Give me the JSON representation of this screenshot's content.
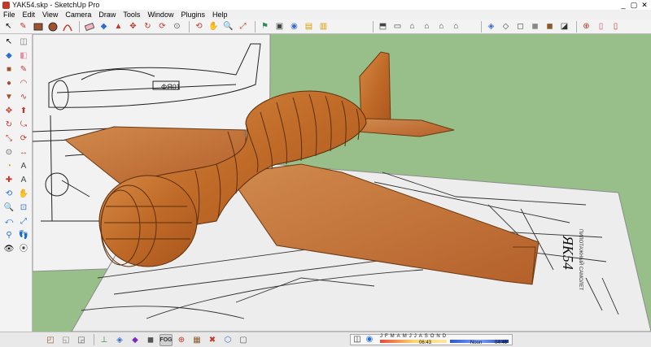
{
  "window": {
    "title": "YAK54.skp - SketchUp Pro",
    "controls": [
      "_",
      "▢",
      "✕"
    ]
  },
  "menu": [
    "File",
    "Edit",
    "View",
    "Camera",
    "Draw",
    "Tools",
    "Window",
    "Plugins",
    "Help"
  ],
  "toolbar_top": {
    "left_icons": [
      "select-arrow-icon",
      "pencil-line-icon",
      "rectangle-icon",
      "circle-icon",
      "arc-icon",
      "eraser-icon",
      "paint-bucket-icon",
      "push-pull-icon",
      "move-icon",
      "rotate-icon",
      "offset-icon",
      "tape-measure-icon",
      "orbit-icon",
      "pan-icon",
      "zoom-icon",
      "zoom-extents-icon",
      "add-location-icon",
      "3d-warehouse-icon",
      "layers-icon",
      "components-icon"
    ],
    "right_icons": [
      "iso-view-icon",
      "top-view-icon",
      "front-view-icon",
      "right-view-icon",
      "back-view-icon",
      "left-view-icon",
      "xray-icon",
      "wireframe-icon",
      "hidden-line-icon",
      "shaded-icon",
      "shaded-texture-icon",
      "monochrome-icon",
      "section-plane-icon",
      "section-display-icon"
    ]
  },
  "toolbar_left": [
    "select-icon",
    "eraser-icon",
    "paint-icon",
    "make-component-icon",
    "rectangle-icon",
    "line-icon",
    "circle-icon",
    "arc-icon",
    "polygon-icon",
    "freehand-icon",
    "move-icon",
    "push-pull-icon",
    "rotate-icon",
    "follow-me-icon",
    "scale-icon",
    "offset-icon",
    "tape-icon",
    "dimension-icon",
    "protractor-icon",
    "text-icon",
    "axes-icon",
    "3d-text-icon",
    "orbit-icon",
    "pan-icon",
    "zoom-icon",
    "zoom-window-icon",
    "previous-view-icon",
    "zoom-extents-icon",
    "position-camera-icon",
    "walk-icon",
    "look-around-icon",
    "section-icon"
  ],
  "statusbar": {
    "icons": [
      "geo-location-icon",
      "credits-icon",
      "help-icon",
      "axes-icon",
      "xray-icon",
      "back-edges-icon",
      "fog-icon",
      "shadows-icon",
      "section-plane-icon",
      "section-cut-icon",
      "section-display-icon"
    ],
    "fog_label": "FOG"
  },
  "shadows": {
    "months": [
      "J",
      "F",
      "M",
      "A",
      "M",
      "J",
      "J",
      "A",
      "S",
      "O",
      "N",
      "D"
    ],
    "times": {
      "morning": "06:43",
      "noon": "Noon",
      "evening": "04:46"
    }
  },
  "colors": {
    "viewport_green": "#98bf8a",
    "wood": "#c06a28",
    "wood_dark": "#8a4716"
  }
}
